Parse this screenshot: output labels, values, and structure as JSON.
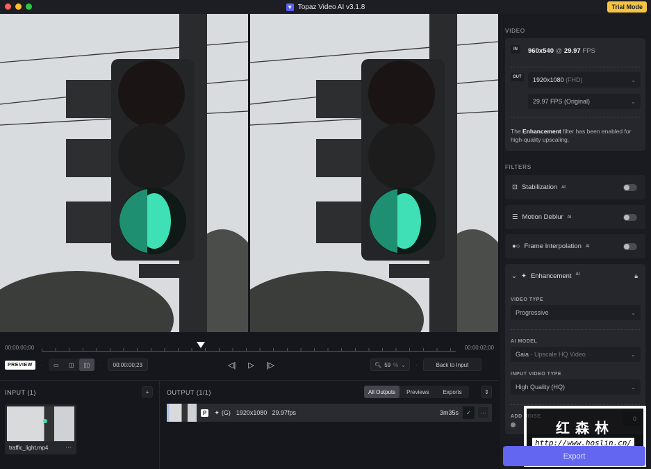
{
  "window": {
    "title": "Topaz Video AI  v3.1.8",
    "trial_label": "Trial Mode"
  },
  "timeline": {
    "start": "00:00:00;00",
    "end": "00:00:02;00",
    "current": "00:00:00;23",
    "preview_label": "PREVIEW",
    "zoom": "59",
    "zoom_unit": "%",
    "back_label": "Back to Input"
  },
  "input": {
    "title": "INPUT (1)",
    "file": "traffic_light.mp4",
    "more": "···",
    "add": "+"
  },
  "output": {
    "title": "OUTPUT (1/1)",
    "tabs": [
      "All Outputs",
      "Previews",
      "Exports"
    ],
    "badge": "P",
    "model": "(G)",
    "resolution": "1920x1080",
    "fps": "29.97fps",
    "eta": "3m35s",
    "check": "✓",
    "more": "···"
  },
  "sidebar": {
    "video_label": "VIDEO",
    "in_tag": "IN",
    "in_res": "960x540",
    "at": "@",
    "in_fps": "29.97",
    "fps_unit": "FPS",
    "out_tag": "OUT",
    "out_res": "1920x1080",
    "out_res_note": "(FHD)",
    "out_fps": "29.97 FPS (Original)",
    "note_pre": "The ",
    "note_bold": "Enhancement",
    "note_post": " filter has been enabled for high-quality upscaling.",
    "filters_label": "FILTERS",
    "filters": [
      {
        "name": "Stabilization",
        "ai": "AI",
        "on": false
      },
      {
        "name": "Motion Deblur",
        "ai": "AI",
        "on": false
      },
      {
        "name": "Frame Interpolation",
        "ai": "AI",
        "on": false
      }
    ],
    "enhancement": {
      "name": "Enhancement",
      "ai": "AI",
      "video_type_label": "VIDEO TYPE",
      "video_type": "Progressive",
      "ai_model_label": "AI MODEL",
      "ai_model_name": "Gaia",
      "ai_model_desc": " - Upscale HQ Video",
      "input_type_label": "INPUT VIDEO TYPE",
      "input_type": "High Quality (HQ)",
      "noise_label": "ADD NOISE",
      "noise_value": "0"
    },
    "export_label": "Export"
  },
  "watermark": {
    "cn": "红森林",
    "url": "http://www.hoslin.cn/"
  }
}
